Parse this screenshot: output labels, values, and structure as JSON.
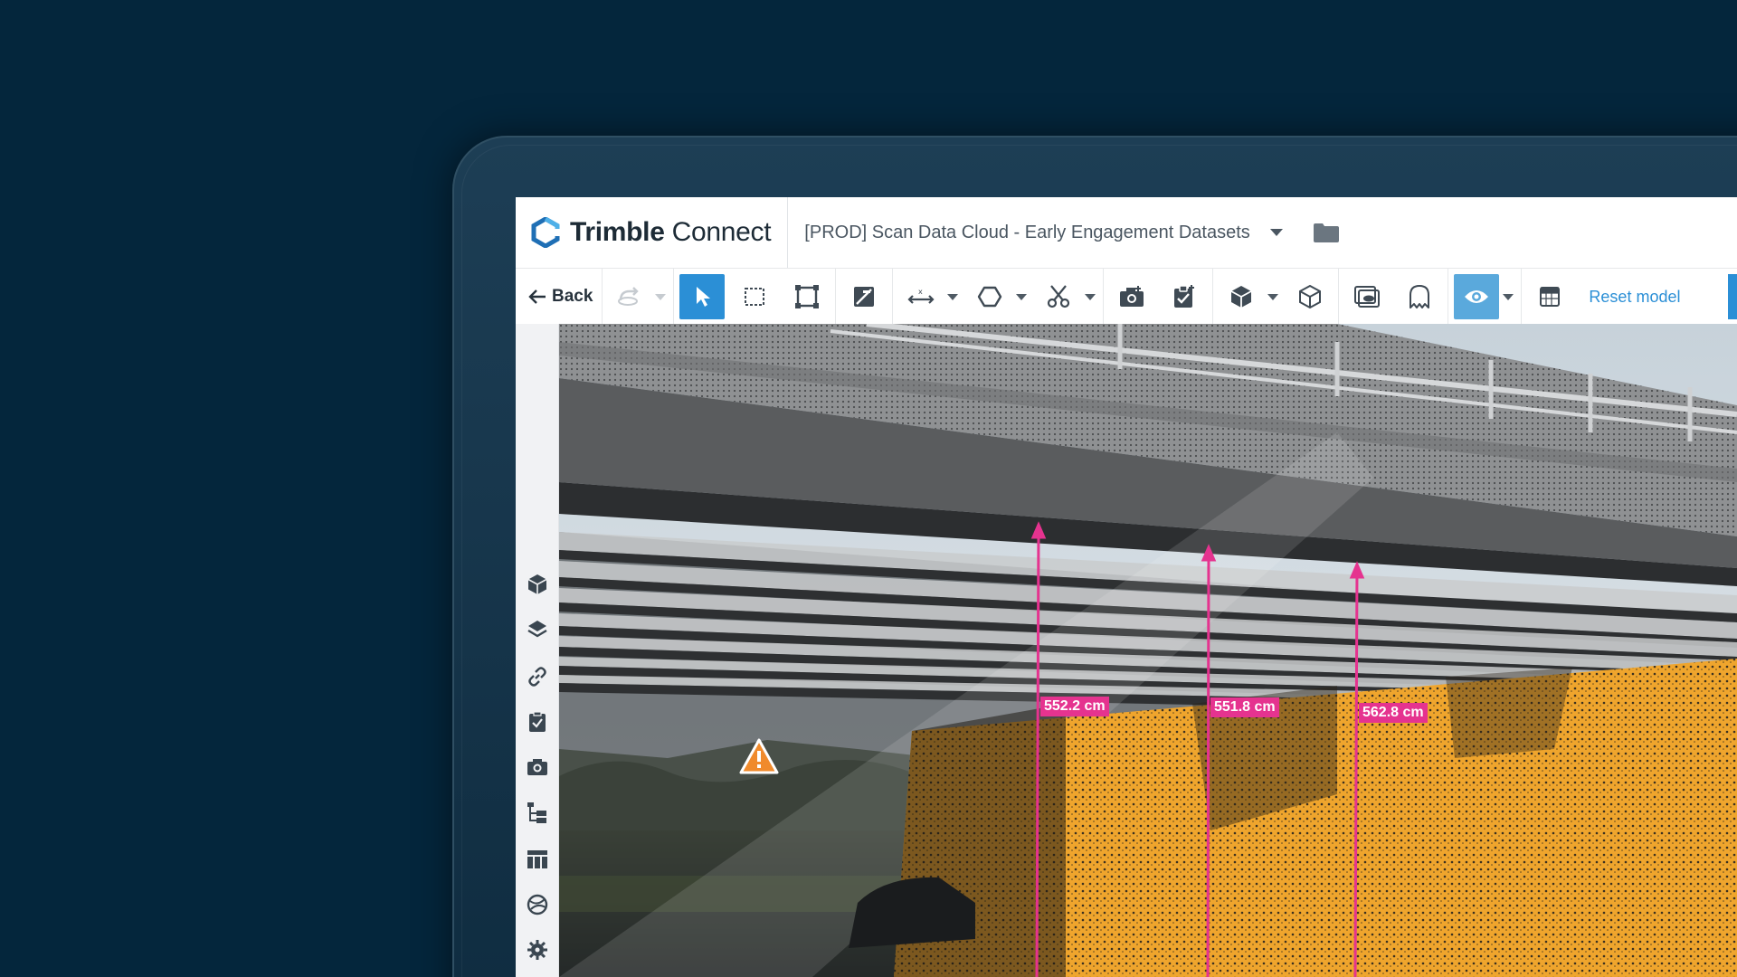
{
  "app": {
    "brand_name": "Trimble Connect",
    "project_title": "[PROD] Scan Data Cloud - Early Engagement Datasets"
  },
  "toolbar": {
    "back_label": "Back",
    "reset_label": "Reset model",
    "icons": [
      "redo-icon",
      "select-pointer-icon",
      "box-select-icon",
      "fit-selection-icon",
      "section-plane-icon",
      "measure-icon",
      "polygon-icon",
      "scissors-icon",
      "snapshot-icon",
      "checklist-icon",
      "cube-icon",
      "cube-outline-icon",
      "viewpoint-icon",
      "ghost-icon",
      "eye-icon",
      "grid-icon"
    ]
  },
  "rail": {
    "items": [
      "model-cube-icon",
      "layers-icon",
      "link-icon",
      "todo-icon",
      "camera-icon",
      "tree-icon",
      "table-icon",
      "globe-icon",
      "settings-icon"
    ]
  },
  "measurements": [
    {
      "label": "552.2 cm"
    },
    {
      "label": "551.8 cm"
    },
    {
      "label": "562.8 cm"
    }
  ],
  "colors": {
    "background": "#04263c",
    "accent": "#2b8fd6",
    "measure": "#e5338f",
    "clash_orange": "#f0a52b"
  }
}
